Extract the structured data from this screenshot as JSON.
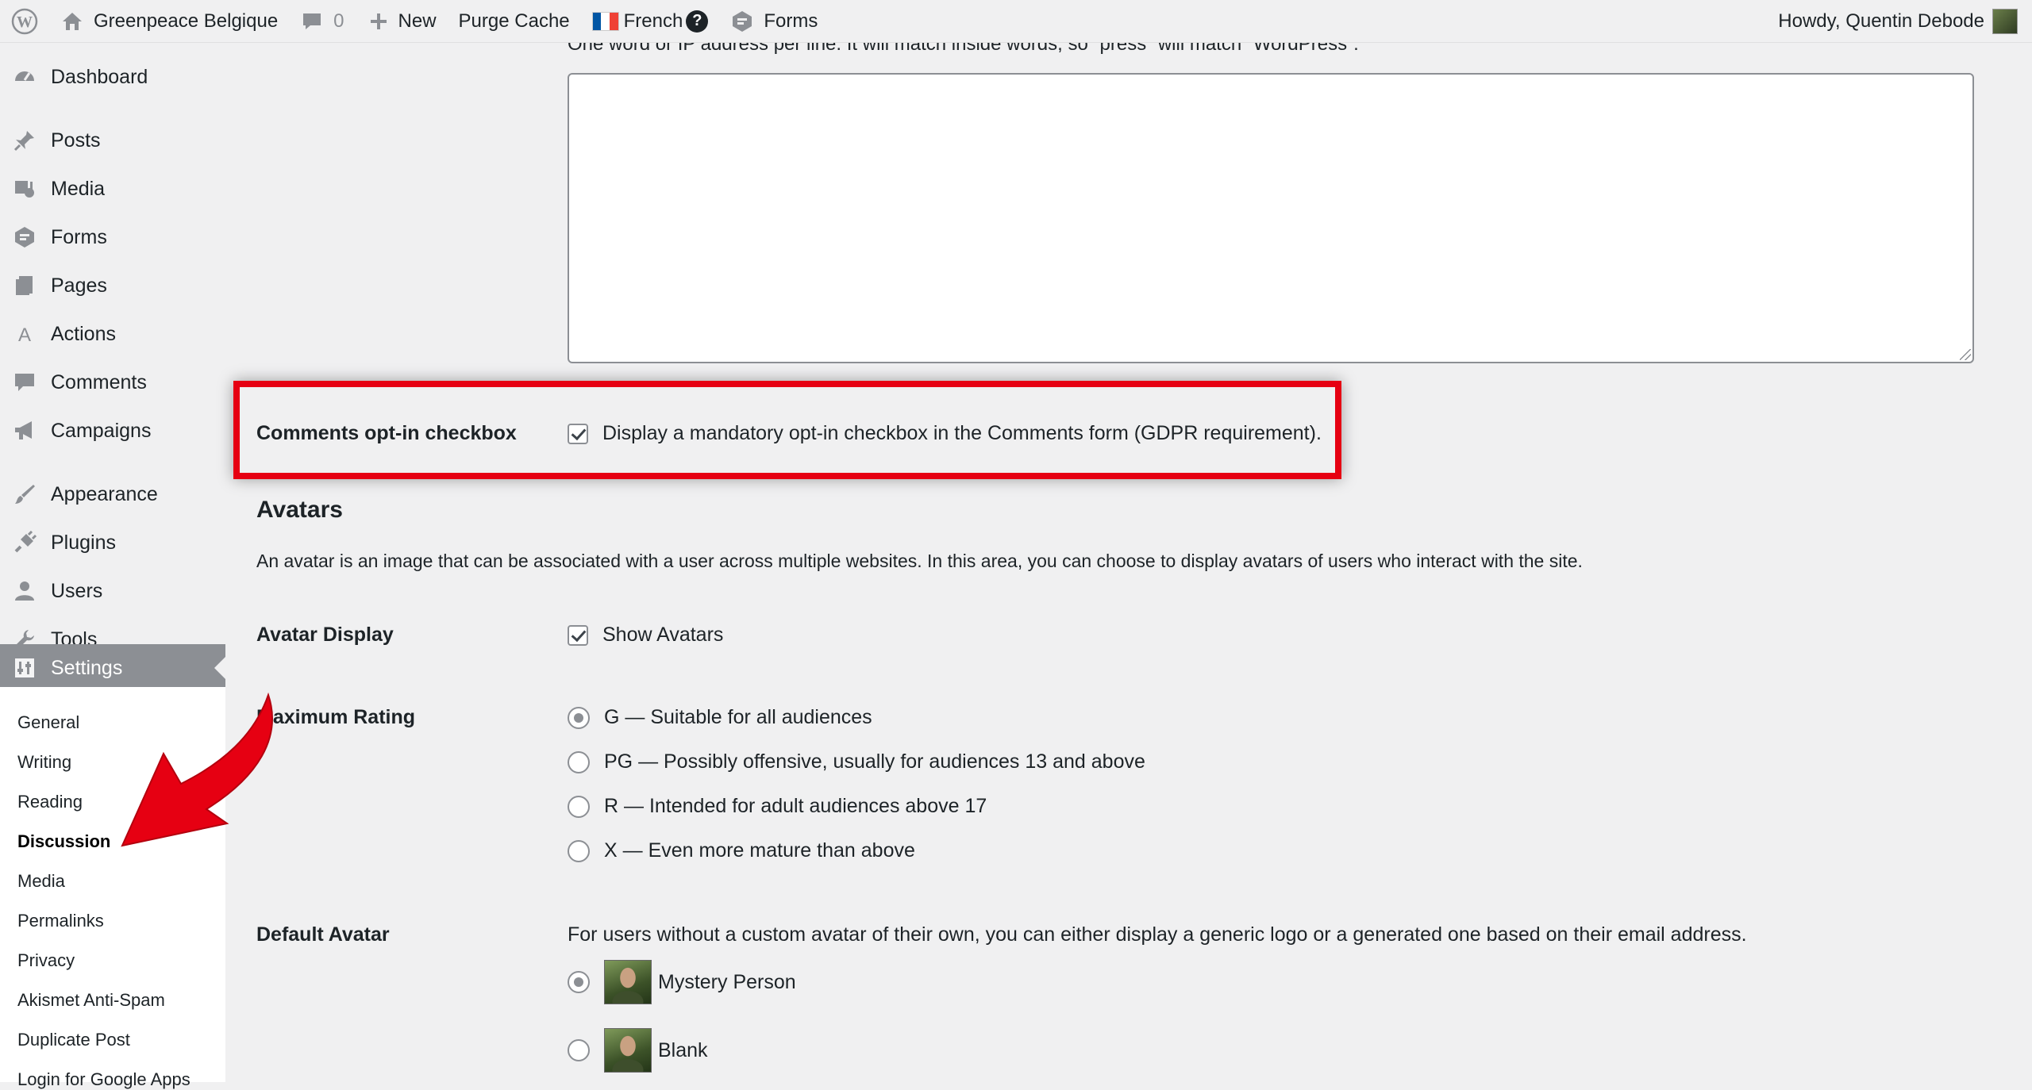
{
  "adminbar": {
    "site_name": "Greenpeace Belgique",
    "comments_count": "0",
    "new_label": "New",
    "purge_cache": "Purge Cache",
    "language": "French",
    "help_glyph": "?",
    "forms": "Forms",
    "howdy": "Howdy, Quentin Debode"
  },
  "sidebar": {
    "items": [
      {
        "label": "Dashboard",
        "icon": "dashboard-icon"
      },
      {
        "label": "Posts",
        "icon": "pin-icon"
      },
      {
        "label": "Media",
        "icon": "media-icon"
      },
      {
        "label": "Forms",
        "icon": "forms-icon"
      },
      {
        "label": "Pages",
        "icon": "pages-icon"
      },
      {
        "label": "Actions",
        "icon": "actions-icon"
      },
      {
        "label": "Comments",
        "icon": "comment-icon"
      },
      {
        "label": "Campaigns",
        "icon": "megaphone-icon"
      },
      {
        "label": "Appearance",
        "icon": "brush-icon"
      },
      {
        "label": "Plugins",
        "icon": "plug-icon"
      },
      {
        "label": "Users",
        "icon": "user-icon"
      },
      {
        "label": "Tools",
        "icon": "wrench-icon"
      },
      {
        "label": "Settings",
        "icon": "settings-icon"
      }
    ],
    "submenu": [
      "General",
      "Writing",
      "Reading",
      "Discussion",
      "Media",
      "Permalinks",
      "Privacy",
      "Akismet Anti-Spam",
      "Duplicate Post",
      "Login for Google Apps"
    ],
    "current_submenu": "Discussion"
  },
  "main": {
    "blocklist_help": "One word or IP address per line. It will match inside words, so “press” will match “WordPress”.",
    "blocklist_value": "",
    "optin": {
      "label": "Comments opt-in checkbox",
      "text": "Display a mandatory opt-in checkbox in the Comments form (GDPR requirement).",
      "checked": true
    },
    "avatars": {
      "heading": "Avatars",
      "description": "An avatar is an image that can be associated with a user across multiple websites. In this area, you can choose to display avatars of users who interact with the site.",
      "display_label": "Avatar Display",
      "display_text": "Show Avatars",
      "display_checked": true,
      "rating_label": "Maximum Rating",
      "ratings": [
        {
          "text": "G — Suitable for all audiences",
          "selected": true
        },
        {
          "text": "PG — Possibly offensive, usually for audiences 13 and above",
          "selected": false
        },
        {
          "text": "R — Intended for adult audiences above 17",
          "selected": false
        },
        {
          "text": "X — Even more mature than above",
          "selected": false
        }
      ],
      "default_label": "Default Avatar",
      "default_description": "For users without a custom avatar of their own, you can either display a generic logo or a generated one based on their email address.",
      "defaults": [
        {
          "text": "Mystery Person",
          "selected": true
        },
        {
          "text": "Blank",
          "selected": false
        }
      ]
    }
  },
  "annotation": {
    "highlight_color": "#e60012",
    "arrow_color": "#e60012"
  }
}
